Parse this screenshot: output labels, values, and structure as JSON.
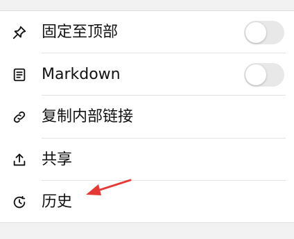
{
  "menu": {
    "items": [
      {
        "label": "固定至顶部",
        "icon": "pin-icon",
        "has_toggle": true,
        "toggle_on": false
      },
      {
        "label": "Markdown",
        "icon": "markdown-doc-icon",
        "has_toggle": true,
        "toggle_on": false
      },
      {
        "label": "复制内部链接",
        "icon": "link-icon",
        "has_toggle": false
      },
      {
        "label": "共享",
        "icon": "share-icon",
        "has_toggle": false
      },
      {
        "label": "历史",
        "icon": "history-icon",
        "has_toggle": false
      }
    ]
  },
  "colors": {
    "background": "#f2f2f2",
    "card": "#ffffff",
    "text": "#111111",
    "toggle_off": "#e8e8e8",
    "annotation_arrow": "#e53935"
  }
}
